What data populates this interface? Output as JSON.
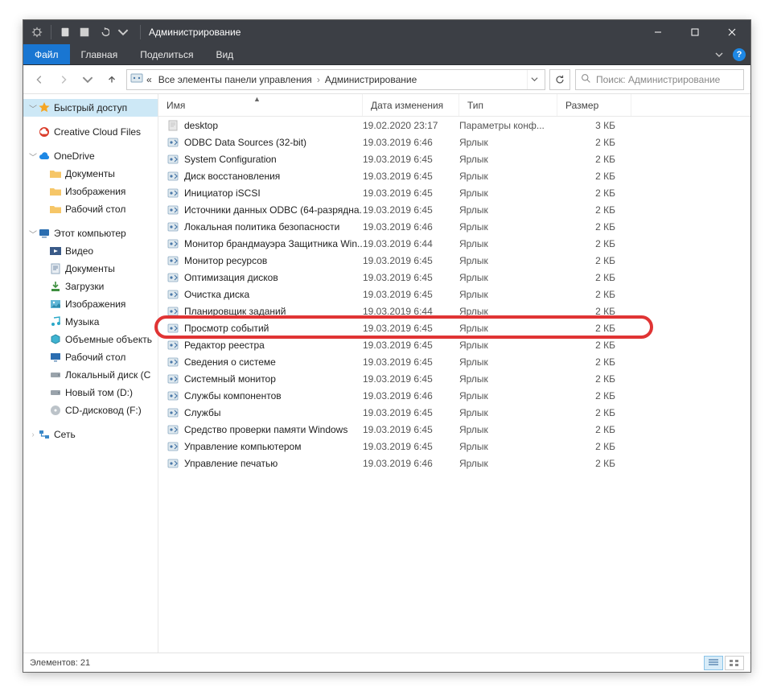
{
  "window": {
    "title": "Администрирование"
  },
  "ribbon": {
    "file": "Файл",
    "home": "Главная",
    "share": "Поделиться",
    "view": "Вид"
  },
  "address": {
    "prefix": "«",
    "crumb1": "Все элементы панели управления",
    "crumb2": "Администрирование"
  },
  "search": {
    "placeholder": "Поиск: Администрирование"
  },
  "sidebar": {
    "quick_access": "Быстрый доступ",
    "creative_cloud": "Creative Cloud Files",
    "onedrive": "OneDrive",
    "onedrive_items": {
      "docs": "Документы",
      "images": "Изображения",
      "desktop": "Рабочий стол"
    },
    "this_pc": "Этот компьютер",
    "pc_items": {
      "videos": "Видео",
      "documents": "Документы",
      "downloads": "Загрузки",
      "pictures": "Изображения",
      "music": "Музыка",
      "objects3d": "Объемные объекть",
      "desktop": "Рабочий стол",
      "local_c": "Локальный диск (C",
      "new_vol_d": "Новый том (D:)",
      "cd_f": "CD-дисковод (F:)"
    },
    "network": "Сеть"
  },
  "columns": {
    "name": "Имя",
    "date": "Дата изменения",
    "type": "Тип",
    "size": "Размер"
  },
  "files": [
    {
      "name": "desktop",
      "date": "19.02.2020 23:17",
      "type": "Параметры конф...",
      "size": "3 КБ",
      "icon": "file"
    },
    {
      "name": "ODBC Data Sources (32-bit)",
      "date": "19.03.2019 6:46",
      "type": "Ярлык",
      "size": "2 КБ",
      "icon": "tool"
    },
    {
      "name": "System Configuration",
      "date": "19.03.2019 6:45",
      "type": "Ярлык",
      "size": "2 КБ",
      "icon": "tool"
    },
    {
      "name": "Диск восстановления",
      "date": "19.03.2019 6:45",
      "type": "Ярлык",
      "size": "2 КБ",
      "icon": "tool"
    },
    {
      "name": "Инициатор iSCSI",
      "date": "19.03.2019 6:45",
      "type": "Ярлык",
      "size": "2 КБ",
      "icon": "tool"
    },
    {
      "name": "Источники данных ODBC (64-разрядна...",
      "date": "19.03.2019 6:45",
      "type": "Ярлык",
      "size": "2 КБ",
      "icon": "tool"
    },
    {
      "name": "Локальная политика безопасности",
      "date": "19.03.2019 6:46",
      "type": "Ярлык",
      "size": "2 КБ",
      "icon": "tool"
    },
    {
      "name": "Монитор брандмауэра Защитника Win...",
      "date": "19.03.2019 6:44",
      "type": "Ярлык",
      "size": "2 КБ",
      "icon": "tool"
    },
    {
      "name": "Монитор ресурсов",
      "date": "19.03.2019 6:45",
      "type": "Ярлык",
      "size": "2 КБ",
      "icon": "tool"
    },
    {
      "name": "Оптимизация дисков",
      "date": "19.03.2019 6:45",
      "type": "Ярлык",
      "size": "2 КБ",
      "icon": "tool"
    },
    {
      "name": "Очистка диска",
      "date": "19.03.2019 6:45",
      "type": "Ярлык",
      "size": "2 КБ",
      "icon": "tool"
    },
    {
      "name": "Планировщик заданий",
      "date": "19.03.2019 6:44",
      "type": "Ярлык",
      "size": "2 КБ",
      "icon": "tool"
    },
    {
      "name": "Просмотр событий",
      "date": "19.03.2019 6:45",
      "type": "Ярлык",
      "size": "2 КБ",
      "icon": "tool",
      "highlight": true
    },
    {
      "name": "Редактор реестра",
      "date": "19.03.2019 6:45",
      "type": "Ярлык",
      "size": "2 КБ",
      "icon": "tool"
    },
    {
      "name": "Сведения о системе",
      "date": "19.03.2019 6:45",
      "type": "Ярлык",
      "size": "2 КБ",
      "icon": "tool"
    },
    {
      "name": "Системный монитор",
      "date": "19.03.2019 6:45",
      "type": "Ярлык",
      "size": "2 КБ",
      "icon": "tool"
    },
    {
      "name": "Службы компонентов",
      "date": "19.03.2019 6:46",
      "type": "Ярлык",
      "size": "2 КБ",
      "icon": "tool"
    },
    {
      "name": "Службы",
      "date": "19.03.2019 6:45",
      "type": "Ярлык",
      "size": "2 КБ",
      "icon": "tool"
    },
    {
      "name": "Средство проверки памяти Windows",
      "date": "19.03.2019 6:45",
      "type": "Ярлык",
      "size": "2 КБ",
      "icon": "tool"
    },
    {
      "name": "Управление компьютером",
      "date": "19.03.2019 6:45",
      "type": "Ярлык",
      "size": "2 КБ",
      "icon": "tool"
    },
    {
      "name": "Управление печатью",
      "date": "19.03.2019 6:46",
      "type": "Ярлык",
      "size": "2 КБ",
      "icon": "tool"
    }
  ],
  "status": {
    "count_label": "Элементов: 21"
  }
}
